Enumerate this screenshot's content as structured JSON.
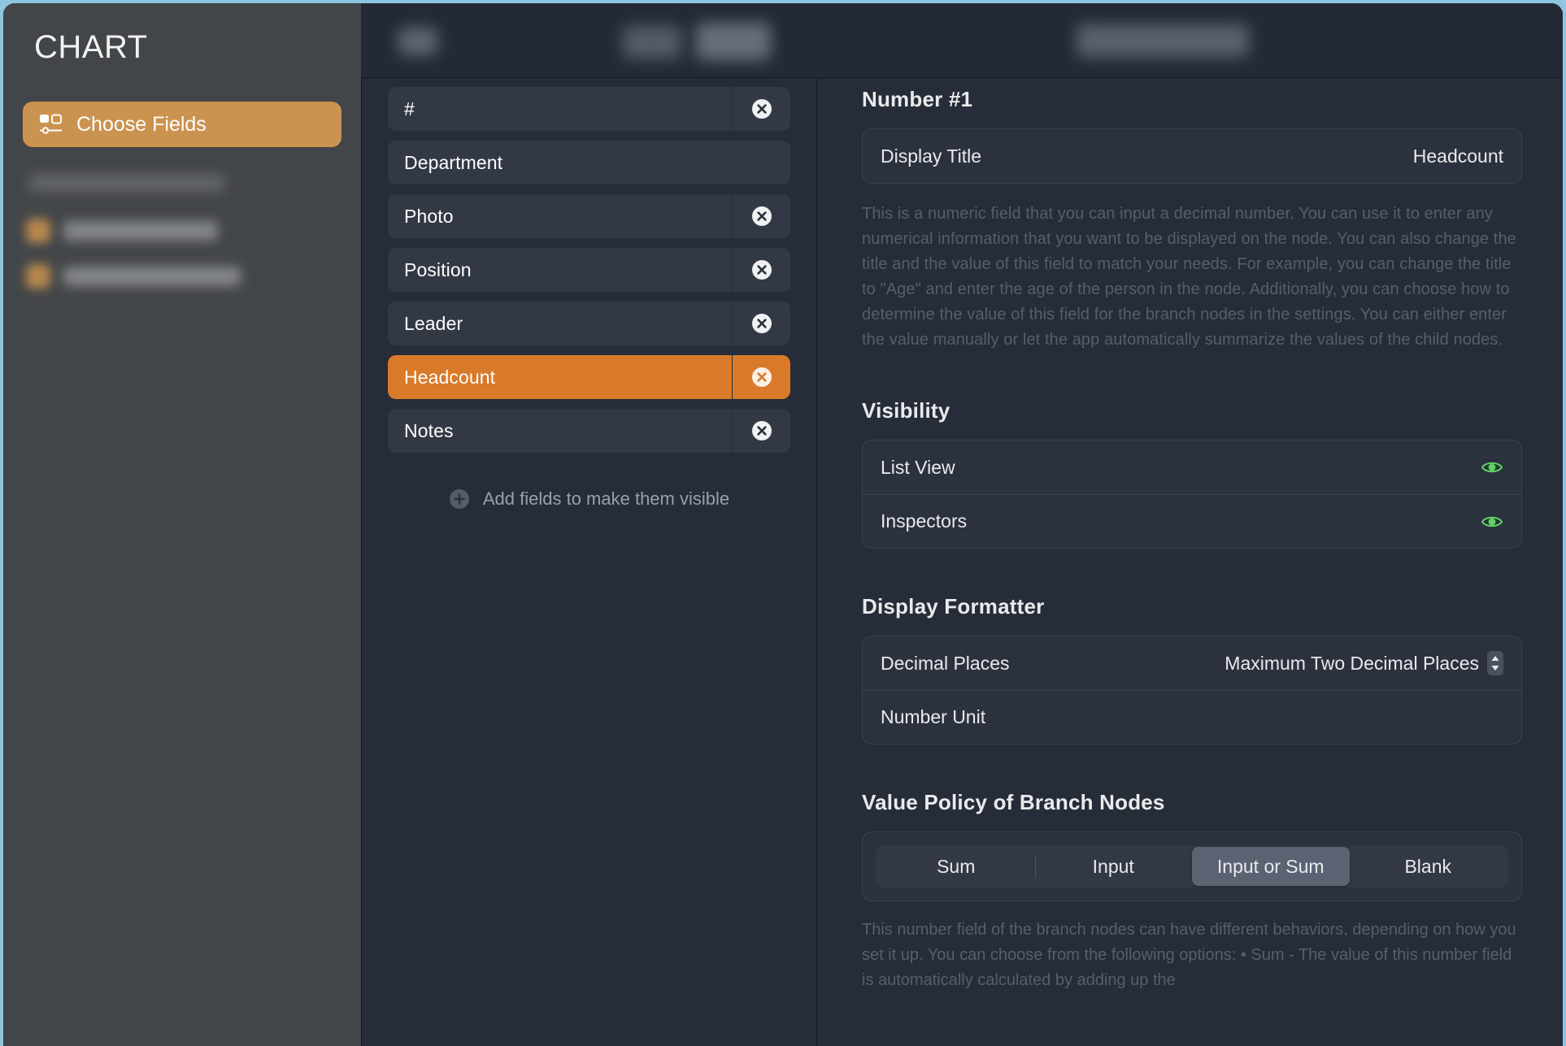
{
  "window": {
    "accent_orange": "#d97a2b",
    "sidebar_accent": "#cb9350",
    "eye_green": "#5fd35f",
    "background_blue": "#8ec5e0"
  },
  "sidebar": {
    "title": "CHART",
    "choose_fields_button": "Choose Fields",
    "choose_fields_icon": "fields-layout-icon"
  },
  "topbar": {
    "redacted": true
  },
  "fields_panel": {
    "fields": [
      {
        "label": "#",
        "removable": true,
        "selected": false
      },
      {
        "label": "Department",
        "removable": false,
        "selected": false
      },
      {
        "label": "Photo",
        "removable": true,
        "selected": false
      },
      {
        "label": "Position",
        "removable": true,
        "selected": false
      },
      {
        "label": "Leader",
        "removable": true,
        "selected": false
      },
      {
        "label": "Headcount",
        "removable": true,
        "selected": true
      },
      {
        "label": "Notes",
        "removable": true,
        "selected": false
      }
    ],
    "add_fields_label": "Add fields to make them visible",
    "add_fields_icon": "plus-circle-icon",
    "remove_icon": "x-circle-icon"
  },
  "inspector": {
    "header": "Number #1",
    "display_title": {
      "label": "Display Title",
      "value": "Headcount"
    },
    "description": "This is a numeric field that you can input a decimal number. You can use it to enter any numerical information that you want to be displayed on the node. You can also change the title and the value of this field to match your needs. For example, you can change the title to \"Age\" and enter the age of the person in the node. Additionally, you can choose how to determine the value of this field for the branch nodes in the settings. You can either enter the value manually or let the app automatically summarize the values of the child nodes.",
    "visibility": {
      "title": "Visibility",
      "rows": [
        {
          "label": "List View",
          "icon": "eye-icon",
          "state": "visible"
        },
        {
          "label": "Inspectors",
          "icon": "eye-icon",
          "state": "visible"
        }
      ]
    },
    "display_formatter": {
      "title": "Display Formatter",
      "decimal_places": {
        "label": "Decimal Places",
        "value": "Maximum Two Decimal Places",
        "icon": "stepper-chevron-icon"
      },
      "number_unit": {
        "label": "Number Unit",
        "value": ""
      }
    },
    "value_policy": {
      "title": "Value Policy of Branch Nodes",
      "options": [
        "Sum",
        "Input",
        "Input or Sum",
        "Blank"
      ],
      "selected": "Input or Sum",
      "description": "This number field of the branch nodes can have different behaviors, depending on how you set it up. You can choose from the following options:\n• Sum - The value of this number field is automatically calculated by adding up the"
    }
  }
}
